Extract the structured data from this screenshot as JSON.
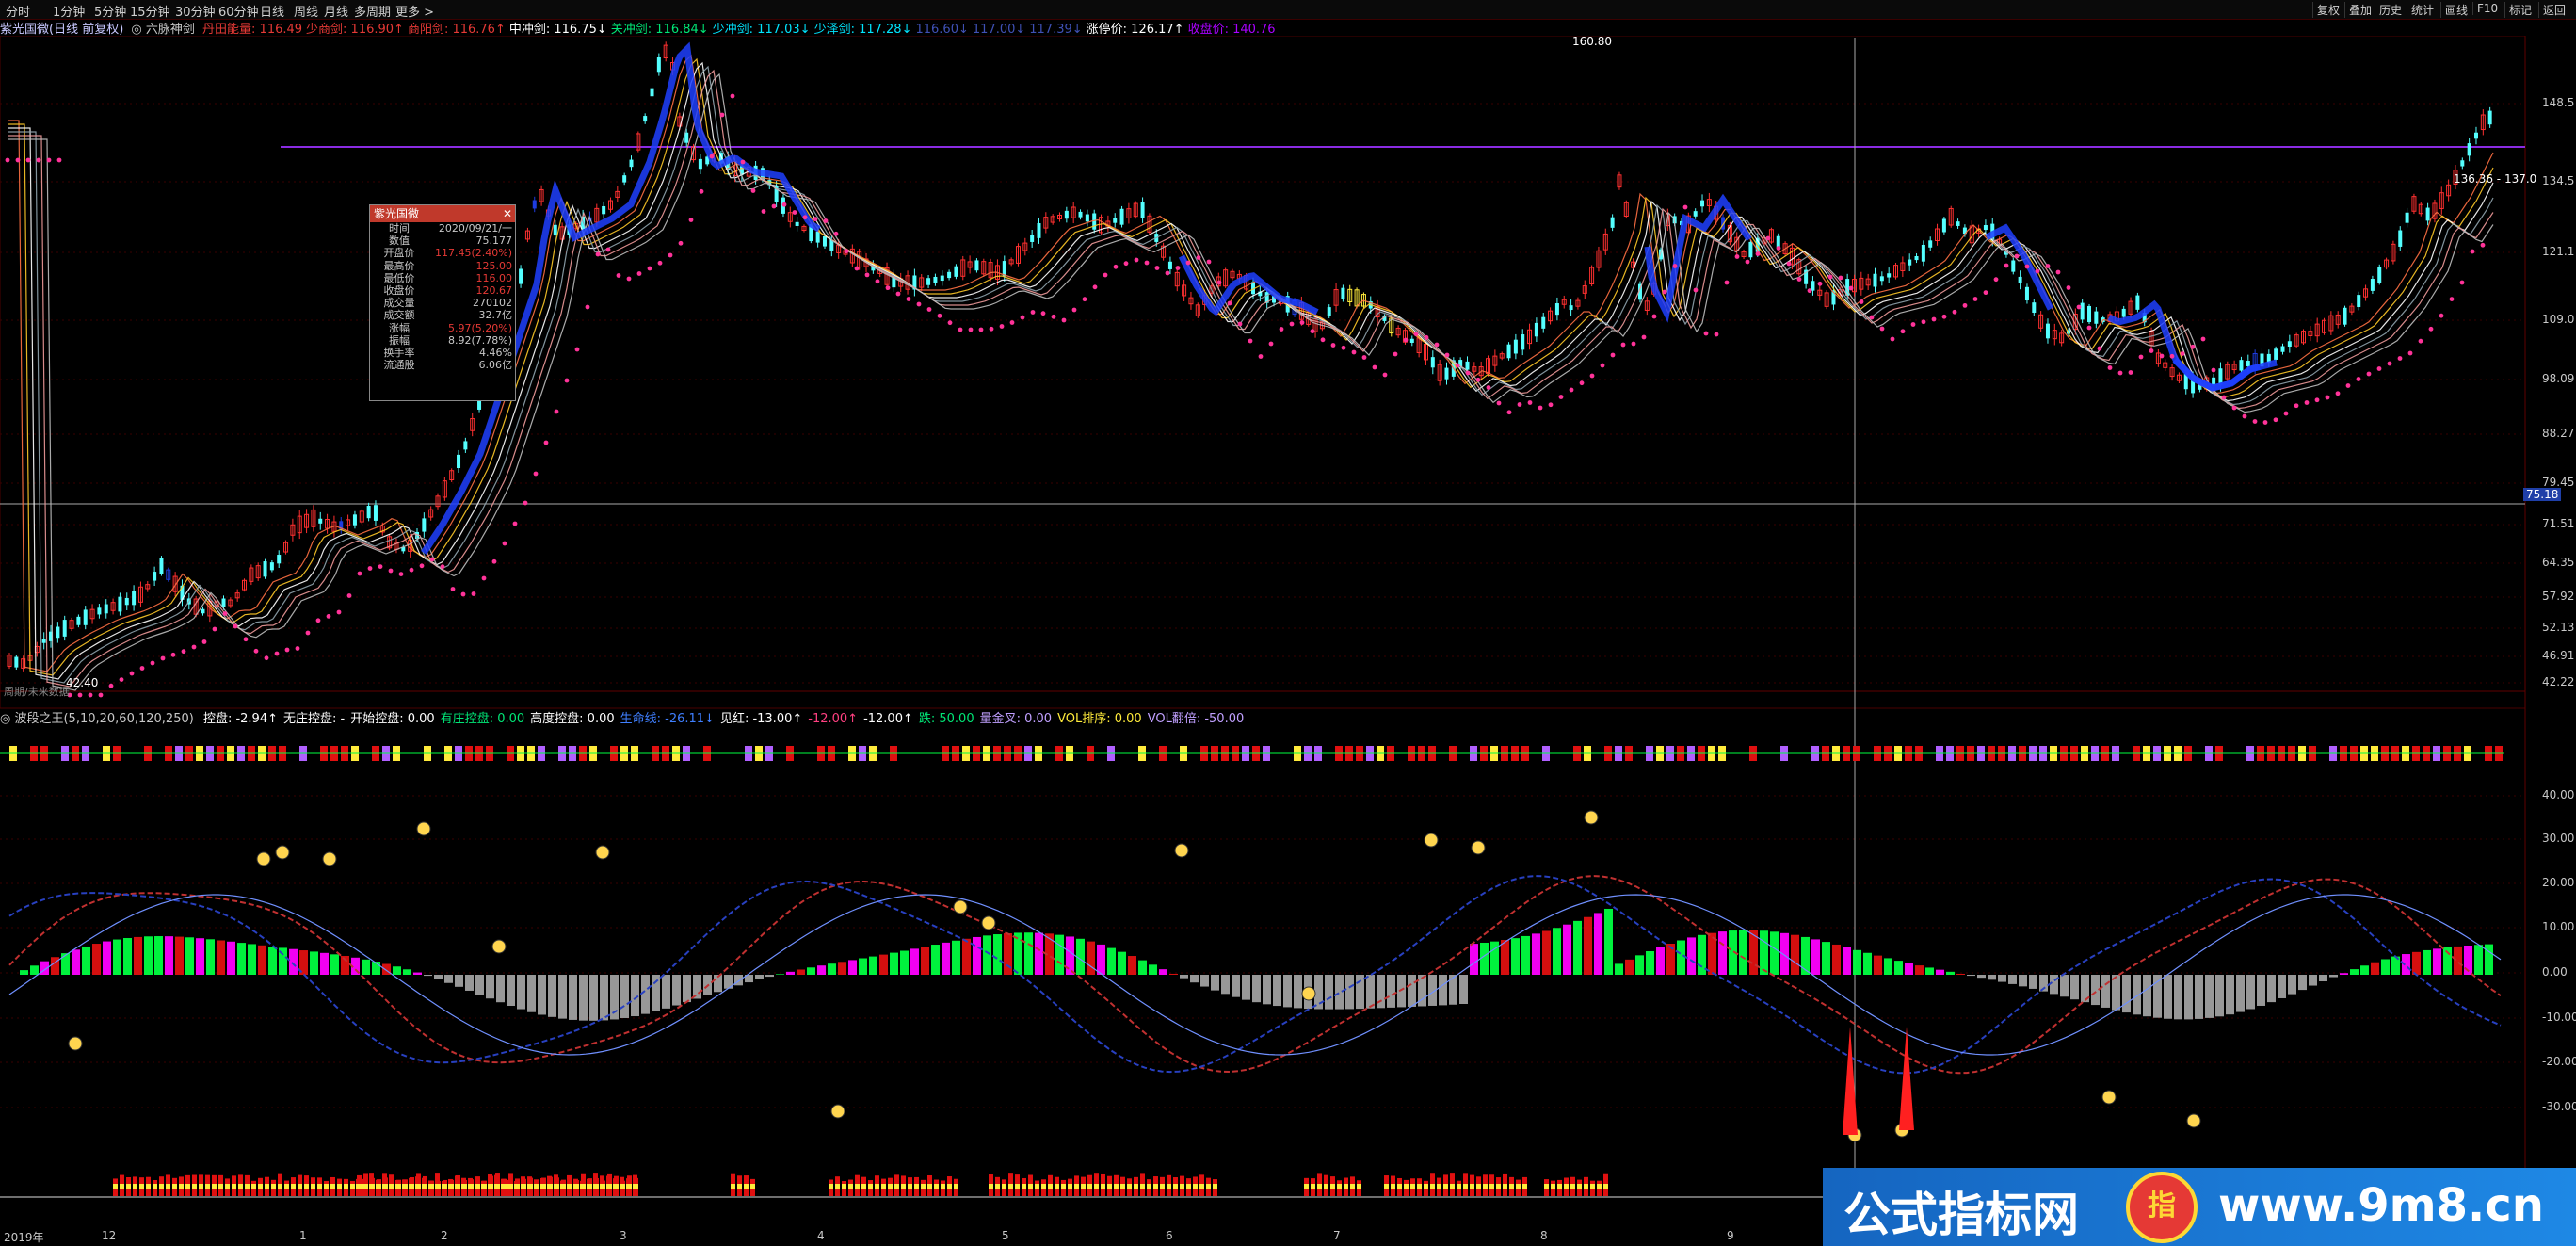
{
  "toolbar": {
    "periods": [
      "分时",
      "1分钟",
      "5分钟",
      "15分钟",
      "30分钟",
      "60分钟",
      "日线",
      "周线",
      "月线",
      "多周期",
      "更多 >"
    ],
    "right": [
      "复权",
      "叠加",
      "历史",
      "统计",
      "画线",
      "F10",
      "标记",
      "返回"
    ]
  },
  "main_header": {
    "stock": "紫光国微(日线 前复权)",
    "indicator": "◎ 六脉神剑",
    "items": [
      {
        "text": "丹田能量: 116.49",
        "color": "#e53935"
      },
      {
        "text": "少商剑: 116.90↑",
        "color": "#e53935"
      },
      {
        "text": "商阳剑: 116.76↑",
        "color": "#e53935"
      },
      {
        "text": "中冲剑: 116.75↓",
        "color": "#ffffff"
      },
      {
        "text": "关冲剑: 116.84↓",
        "color": "#00e676"
      },
      {
        "text": "少冲剑: 117.03↓",
        "color": "#00e5ff"
      },
      {
        "text": "少泽剑: 117.28↓",
        "color": "#00e5ff"
      },
      {
        "text": "116.60↓",
        "color": "#3f51b5"
      },
      {
        "text": "117.00↓",
        "color": "#3f51b5"
      },
      {
        "text": "117.39↓",
        "color": "#3f51b5"
      },
      {
        "text": "涨停价: 126.17↑",
        "color": "#ffffff"
      },
      {
        "text": "收盘价: 140.76",
        "color": "#aa00ff"
      }
    ]
  },
  "popup": {
    "title": "紫光国微",
    "rows": [
      {
        "k": "时间",
        "v": "2020/09/21/一",
        "c": "#c8c8c8"
      },
      {
        "k": "数值",
        "v": "75.177",
        "c": "#c8c8c8"
      },
      {
        "k": "开盘价",
        "v": "117.45(2.40%)",
        "c": "#e53935"
      },
      {
        "k": "最高价",
        "v": "125.00",
        "c": "#e53935"
      },
      {
        "k": "最低价",
        "v": "116.00",
        "c": "#e53935"
      },
      {
        "k": "收盘价",
        "v": "120.67",
        "c": "#e53935"
      },
      {
        "k": "成交量",
        "v": "270102",
        "c": "#c8c8c8"
      },
      {
        "k": "成交额",
        "v": "32.7亿",
        "c": "#c8c8c8"
      },
      {
        "k": "涨幅",
        "v": "5.97(5.20%)",
        "c": "#e53935"
      },
      {
        "k": "振幅",
        "v": "8.92(7.78%)",
        "c": "#c8c8c8"
      },
      {
        "k": "换手率",
        "v": "4.46%",
        "c": "#c8c8c8"
      },
      {
        "k": "流通股",
        "v": "6.06亿",
        "c": "#c8c8c8"
      }
    ]
  },
  "main_y_labels": [
    "148.5",
    "134.5",
    "121.1",
    "109.0",
    "98.09",
    "88.27",
    "79.45",
    "71.51",
    "64.35",
    "57.92",
    "52.13",
    "46.91",
    "42.22"
  ],
  "main_annotations": {
    "high": "160.80",
    "low": "42.40",
    "hint": "周期/未来数据",
    "right_value": "136.36 - 137.0",
    "cursor_value": "75.18"
  },
  "sub_header": {
    "indicator": "◎ 波段之王(5,10,20,60,120,250)",
    "items": [
      {
        "text": "控盘: -2.94↑",
        "color": "#ffffff"
      },
      {
        "text": "无庄控盘: -",
        "color": "#ffffff"
      },
      {
        "text": "开始控盘: 0.00",
        "color": "#ffffff"
      },
      {
        "text": "有庄控盘: 0.00",
        "color": "#00e676"
      },
      {
        "text": "高度控盘: 0.00",
        "color": "#ffffff"
      },
      {
        "text": "生命线: -26.11↓",
        "color": "#3f7fff"
      },
      {
        "text": "见红: -13.00↑",
        "color": "#ffffff"
      },
      {
        "text": "-12.00↑",
        "color": "#ff4081"
      },
      {
        "text": "-12.00↑",
        "color": "#ffffff"
      },
      {
        "text": "跌: 50.00",
        "color": "#00e676"
      },
      {
        "text": "量金叉: 0.00",
        "color": "#c0a0ff"
      },
      {
        "text": "VOL排序: 0.00",
        "color": "#ffeb3b"
      },
      {
        "text": "VOL翻倍: -50.00",
        "color": "#c0a0ff"
      }
    ]
  },
  "sub_y_labels": [
    "40.00",
    "30.00",
    "20.00",
    "10.00",
    "0.00",
    "-10.00",
    "-20.00",
    "-30.00"
  ],
  "x_labels": [
    "2019年",
    "12",
    "1",
    "2",
    "3",
    "4",
    "5",
    "6",
    "7",
    "8",
    "9"
  ],
  "watermark": {
    "left": "公式指标网",
    "logo": "指",
    "right": "www.9m8.cn"
  },
  "colors": {
    "up": "#ff3030",
    "down": "#54ffff",
    "limit_up": "#ffeb3b",
    "big_down": "#1e3ce0",
    "dots": "#ff3399",
    "purple": "#c040ff",
    "green": "#00ff40",
    "magenta": "#ff00ff",
    "red": "#e01010",
    "gray": "#a0a0a0"
  }
}
